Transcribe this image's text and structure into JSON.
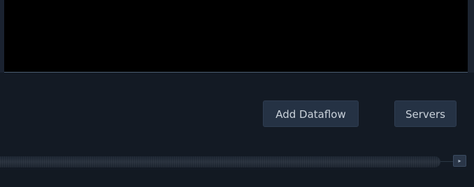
{
  "toolbar": {
    "add_dataflow_label": "Add Dataflow",
    "servers_label": "Servers"
  },
  "scrollbar": {
    "right_arrow_icon": "▸"
  },
  "colors": {
    "background": "#131a24",
    "view_area": "#000000",
    "button_bg": "#253244",
    "button_text": "#c9d1da"
  }
}
